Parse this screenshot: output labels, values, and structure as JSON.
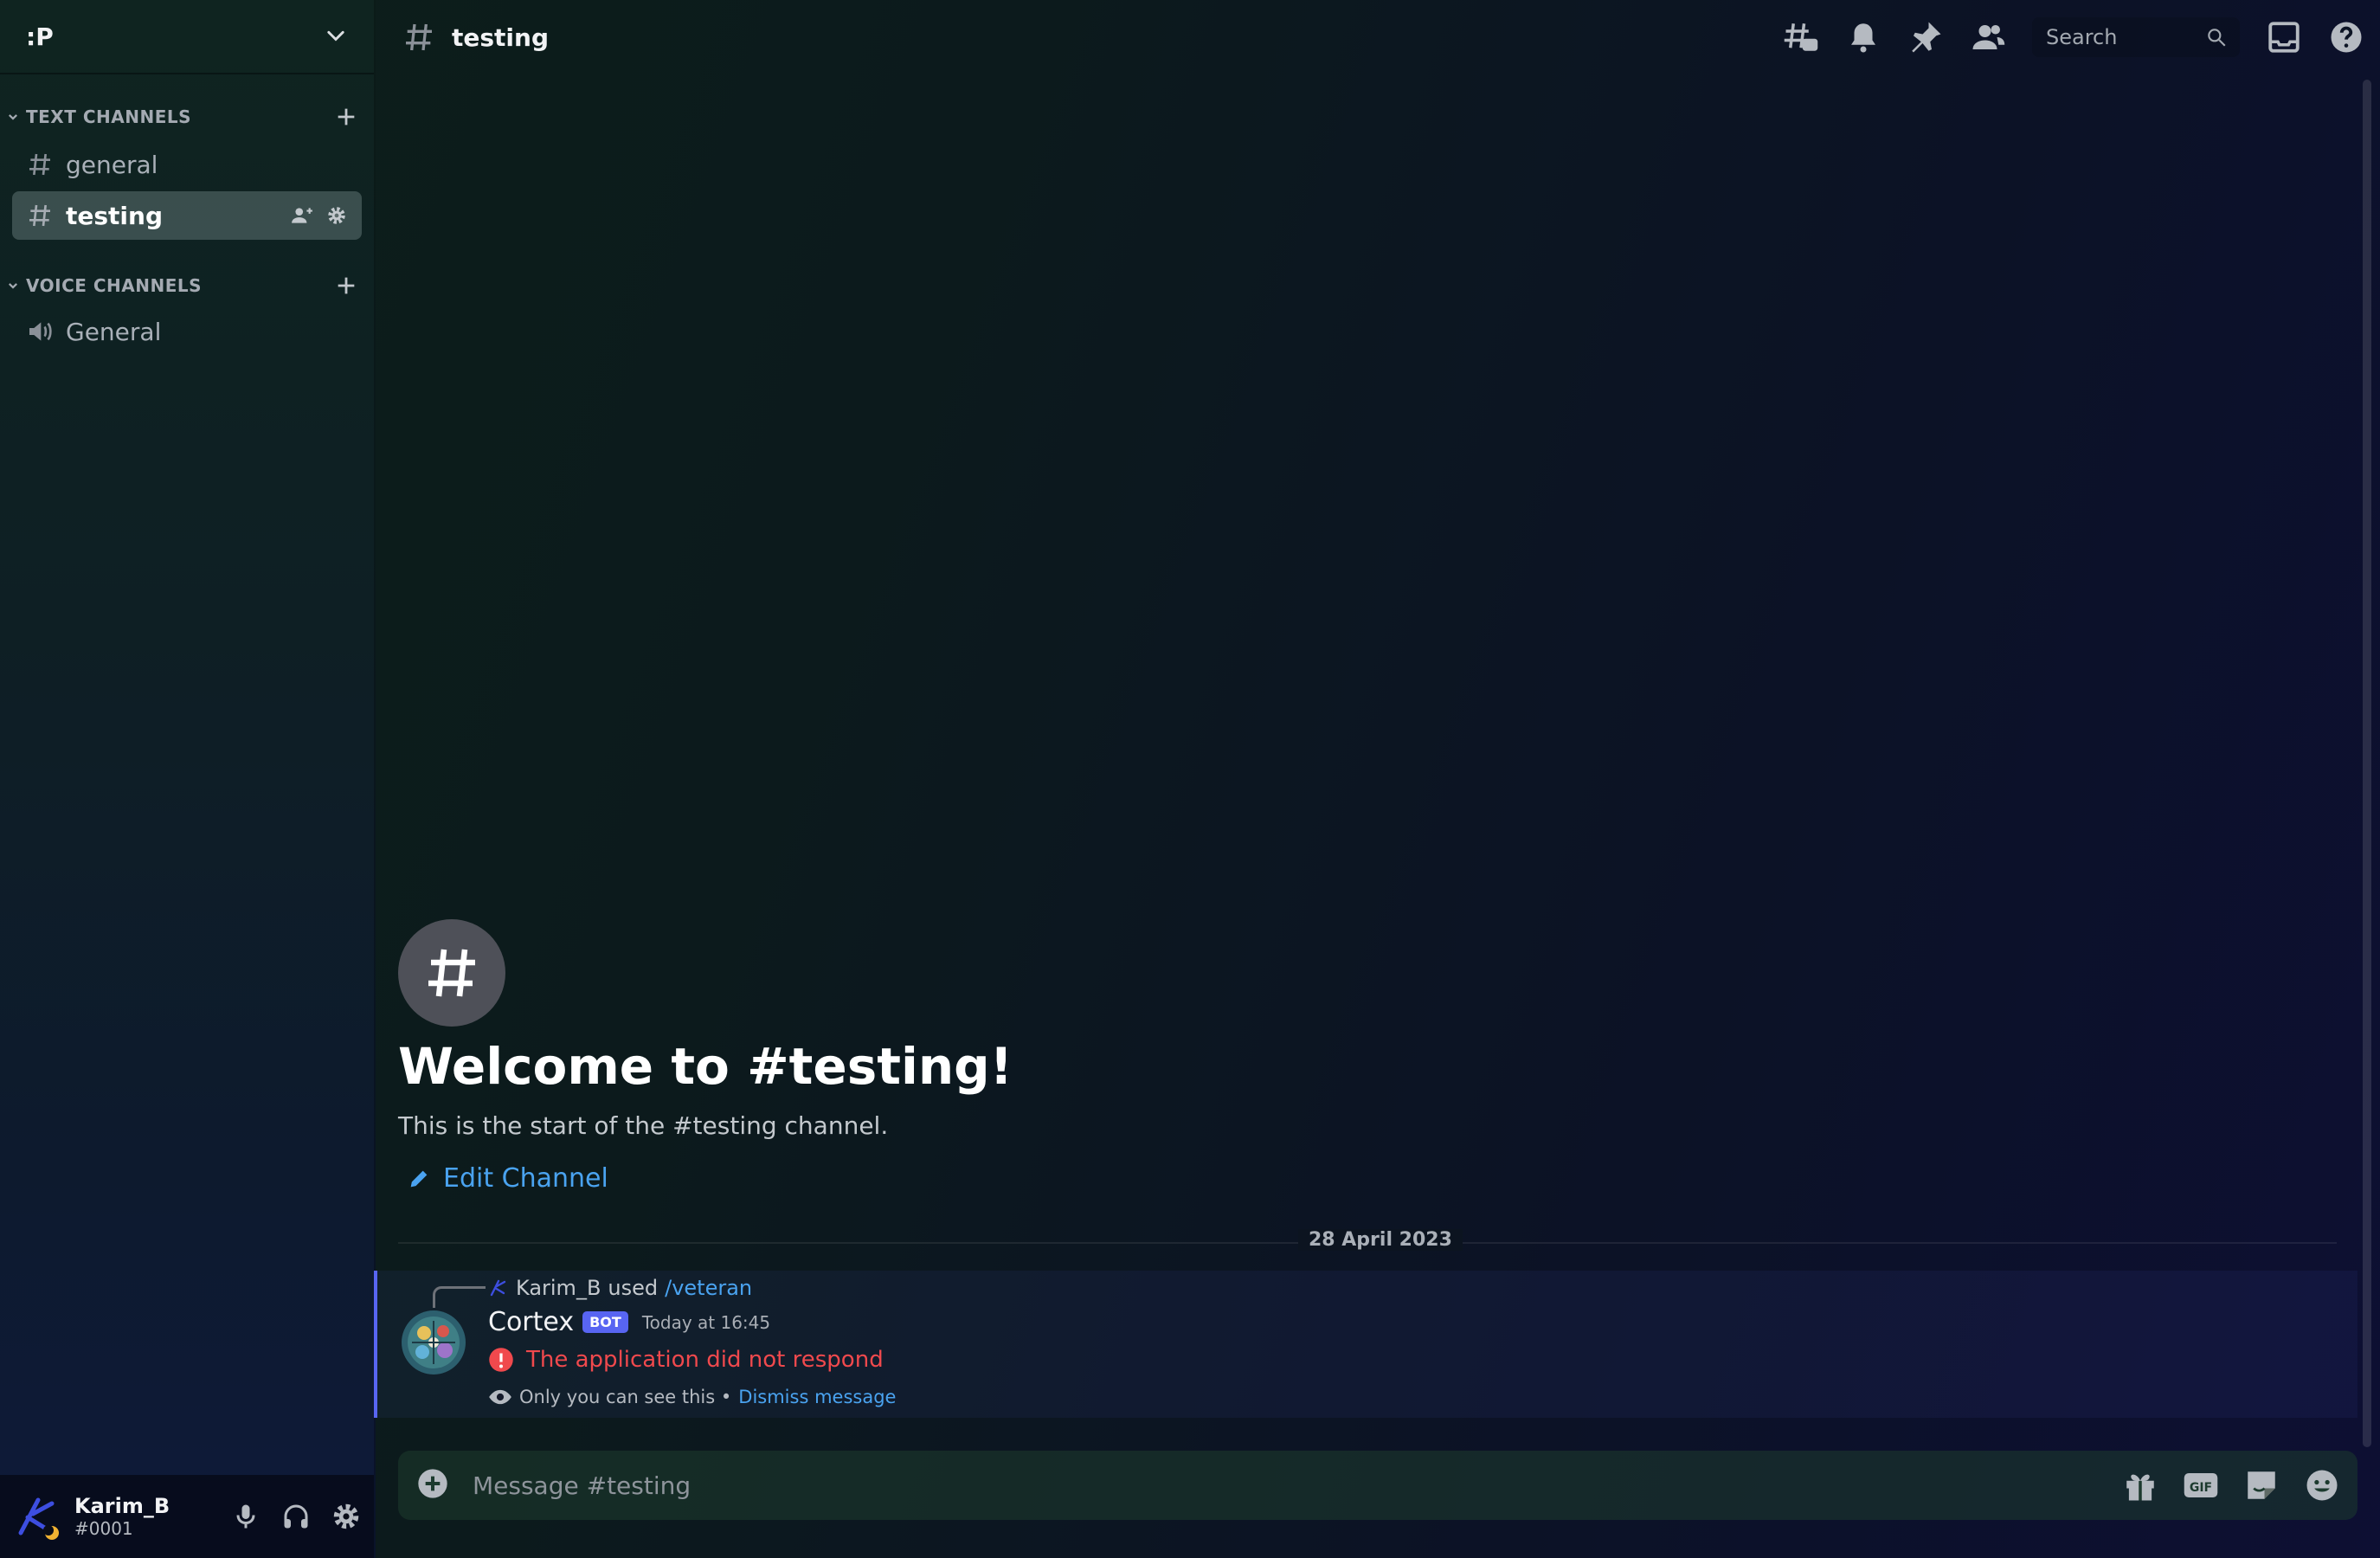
{
  "server": {
    "name": ":P"
  },
  "sidebar": {
    "categories": [
      {
        "label": "TEXT CHANNELS",
        "channels": [
          {
            "name": "general"
          },
          {
            "name": "testing"
          }
        ]
      },
      {
        "label": "VOICE CHANNELS",
        "channels": [
          {
            "name": "General"
          }
        ]
      }
    ]
  },
  "user": {
    "name": "Karim_B",
    "tag": "#0001"
  },
  "header": {
    "channel": "testing",
    "search_placeholder": "Search"
  },
  "welcome": {
    "title": "Welcome to #testing!",
    "subtitle": "This is the start of the #testing channel.",
    "edit_label": "Edit Channel"
  },
  "date_divider": "28 April 2023",
  "message": {
    "reply_user": "Karim_B",
    "reply_used": "used",
    "reply_command": "/veteran",
    "author": "Cortex",
    "bot_tag": "BOT",
    "timestamp": "Today at 16:45",
    "error": "The application did not respond",
    "ephemeral_note": "Only you can see this •",
    "dismiss": "Dismiss message"
  },
  "composer": {
    "placeholder": "Message #testing"
  },
  "colors": {
    "accent": "#5865f2",
    "link": "#4aa3f0",
    "error": "#f0494d"
  },
  "icons": {
    "topbar": [
      "threads-icon",
      "bell-icon",
      "pin-icon",
      "members-icon",
      "search-icon",
      "inbox-icon",
      "help-icon"
    ],
    "composer": [
      "plus-circle-icon",
      "gift-icon",
      "gif-icon",
      "sticker-icon",
      "emoji-icon"
    ],
    "user": [
      "microphone-icon",
      "headphones-icon",
      "gear-icon"
    ]
  }
}
